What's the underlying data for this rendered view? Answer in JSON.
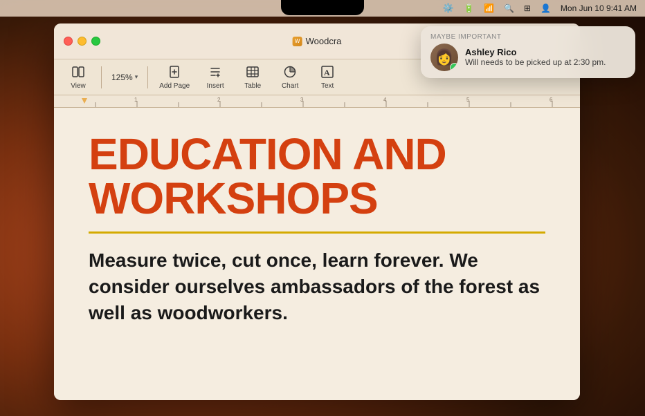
{
  "desktop": {
    "background": "macOS Ventura wallpaper"
  },
  "menubar": {
    "time": "Mon Jun 10  9:41 AM",
    "icons": [
      "settings",
      "battery",
      "wifi",
      "search",
      "controlcenter",
      "user"
    ]
  },
  "window": {
    "title": "Woodcra",
    "traffic_lights": {
      "close": "Close",
      "minimize": "Minimize",
      "maximize": "Maximize"
    }
  },
  "toolbar": {
    "view_label": "View",
    "zoom_value": "125%",
    "zoom_chevron": "▾",
    "addpage_label": "Add Page",
    "insert_label": "Insert",
    "table_label": "Table",
    "chart_label": "Chart",
    "text_label": "Text"
  },
  "document": {
    "heading": "EDUCATION AND WORKSHOPS",
    "body": "Measure twice, cut once, learn forever. We consider ourselves ambassadors of the forest as well as woodworkers."
  },
  "notification": {
    "category": "MAYBE IMPORTANT",
    "sender": "Ashley Rico",
    "message": "Will needs to be picked up at 2:30 pm.",
    "avatar_emoji": "👩"
  }
}
